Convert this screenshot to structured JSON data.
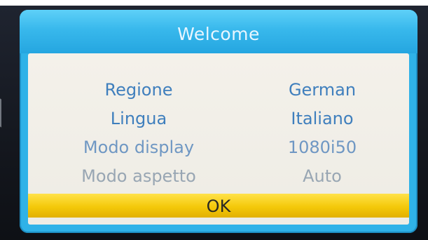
{
  "dialog": {
    "title": "Welcome",
    "rows": [
      {
        "label": "Regione",
        "value": "German"
      },
      {
        "label": "Lingua",
        "value": "Italiano"
      },
      {
        "label": "Modo display",
        "value": "1080i50"
      },
      {
        "label": "Modo aspetto",
        "value": "Auto"
      }
    ],
    "ok_label": "OK"
  },
  "colors": {
    "frame": "#2fb2e8",
    "title_text": "#e8f6ff",
    "panel_bg": "#f4f1ea",
    "row_text": "#3f7fbd",
    "ok_bar": "#f4c90a"
  }
}
